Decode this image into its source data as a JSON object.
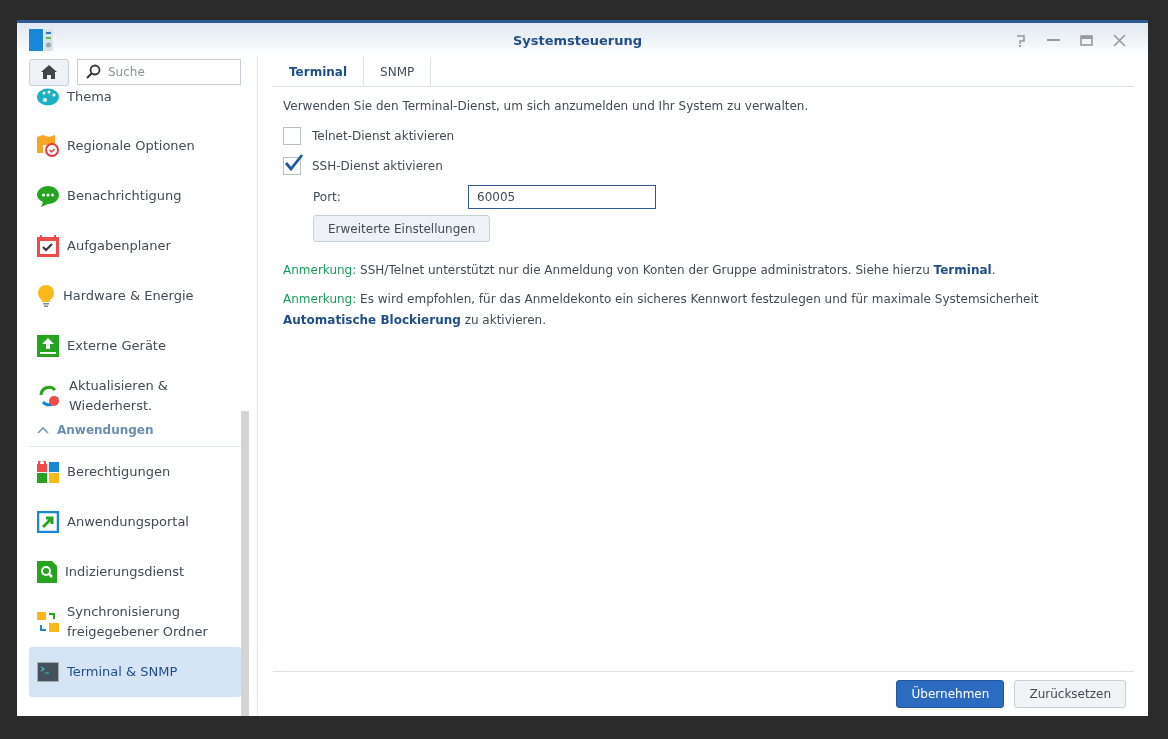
{
  "window": {
    "title": "Systemsteuerung"
  },
  "search": {
    "placeholder": "Suche"
  },
  "sidebar": {
    "items": [
      {
        "kind": "item",
        "label": "Thema",
        "selected": false
      },
      {
        "kind": "item",
        "label": "Regionale Optionen",
        "selected": false
      },
      {
        "kind": "item",
        "label": "Benachrichtigung",
        "selected": false
      },
      {
        "kind": "item",
        "label": "Aufgabenplaner",
        "selected": false
      },
      {
        "kind": "item",
        "label": "Hardware & Energie",
        "selected": false
      },
      {
        "kind": "item",
        "label": "Externe Geräte",
        "selected": false
      },
      {
        "kind": "item",
        "label": "Aktualisieren & Wiederherst.",
        "selected": false
      },
      {
        "kind": "header",
        "label": "Anwendungen",
        "expanded": true
      },
      {
        "kind": "item",
        "label": "Berechtigungen",
        "selected": false
      },
      {
        "kind": "item",
        "label": "Anwendungsportal",
        "selected": false
      },
      {
        "kind": "item",
        "label": "Indizierungsdienst",
        "selected": false
      },
      {
        "kind": "item",
        "label": "Synchronisierung freigegebener Ordner",
        "selected": false
      },
      {
        "kind": "item",
        "label": "Terminal & SNMP",
        "selected": true
      }
    ]
  },
  "tabs": [
    {
      "label": "Terminal",
      "selected": true
    },
    {
      "label": "SNMP",
      "selected": false
    }
  ],
  "intro": "Verwenden Sie den Terminal-Dienst, um sich anzumelden und Ihr System zu verwalten.",
  "options": [
    {
      "label": "Telnet-Dienst aktivieren",
      "checked": false
    },
    {
      "label": "SSH-Dienst aktivieren",
      "checked": true
    }
  ],
  "port": {
    "label": "Port:",
    "value": "60005"
  },
  "advanced_button": "Erweiterte Einstellungen",
  "notes": [
    {
      "label": "Anmerkung:",
      "text": "SSH/Telnet unterstützt nur die Anmeldung von Konten der Gruppe administrators. Siehe hierzu",
      "link": "Terminal",
      "after": "."
    },
    {
      "label": "Anmerkung:",
      "text": "Es wird empfohlen, für das Anmeldekonto ein sicheres Kennwort festzulegen und für maximale Systemsicherheit",
      "link": "Automatische Blockierung",
      "after": " zu aktivieren."
    }
  ],
  "buttons": [
    {
      "label": "Übernehmen",
      "kind": "primary"
    },
    {
      "label": "Zurücksetzen",
      "kind": "secondary"
    }
  ]
}
